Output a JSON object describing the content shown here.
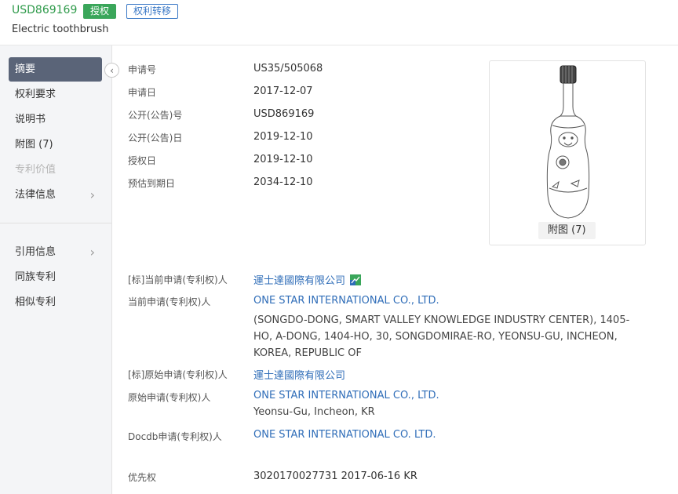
{
  "header": {
    "pub_no": "USD869169",
    "status_badge": "授权",
    "transfer_badge": "权利转移",
    "title": "Electric toothbrush"
  },
  "sidebar": {
    "items": [
      {
        "label": "摘要"
      },
      {
        "label": "权利要求"
      },
      {
        "label": "说明书"
      },
      {
        "label": "附图 (7)"
      },
      {
        "label": "专利价值"
      },
      {
        "label": "法律信息"
      },
      {
        "label": "引用信息"
      },
      {
        "label": "同族专利"
      },
      {
        "label": "相似专利"
      }
    ],
    "chevron": "›",
    "collapse_icon": "‹"
  },
  "details": {
    "app_no_label": "申请号",
    "app_no": "US35/505068",
    "app_date_label": "申请日",
    "app_date": "2017-12-07",
    "pub_no_label": "公开(公告)号",
    "pub_no": "USD869169",
    "pub_date_label": "公开(公告)日",
    "pub_date": "2019-12-10",
    "grant_date_label": "授权日",
    "grant_date": "2019-12-10",
    "expiry_label": "预估到期日",
    "expiry": "2034-12-10"
  },
  "figure": {
    "caption": "附图 (7)"
  },
  "applicants": {
    "std_current_label": "[标]当前申请(专利权)人",
    "std_current": "運士達國際有限公司",
    "current_label": "当前申请(专利权)人",
    "current": "ONE STAR INTERNATIONAL CO., LTD.",
    "current_address": "(SONGDO-DONG, SMART VALLEY KNOWLEDGE INDUSTRY CENTER), 1405-HO, A-DONG, 1404-HO, 30, SONGDOMIRAE-RO, YEONSU-GU, INCHEON, KOREA, REPUBLIC OF",
    "std_original_label": "[标]原始申请(专利权)人",
    "std_original": "運士達國際有限公司",
    "original_label": "原始申请(专利权)人",
    "original": "ONE STAR INTERNATIONAL CO., LTD.",
    "original_address": "Yeonsu-Gu, Incheon, KR",
    "docdb_label": "Docdb申请(专利权)人",
    "docdb": "ONE STAR INTERNATIONAL CO. LTD."
  },
  "priority": {
    "label": "优先权",
    "value": "3020170027731 2017-06-16 KR"
  },
  "colors": {
    "brand_green": "#3aa65a",
    "link_blue": "#2f6db8",
    "active_nav": "#5a6478"
  }
}
